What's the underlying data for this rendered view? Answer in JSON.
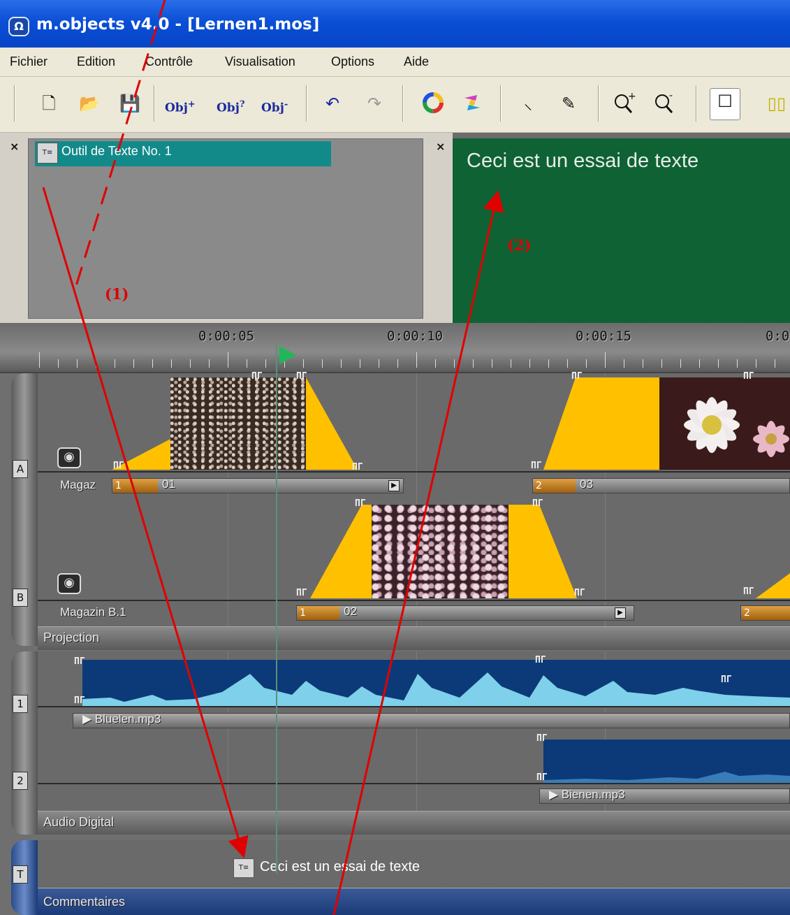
{
  "window": {
    "title": "m.objects v4.0 - [Lernen1.mos]",
    "icon": "m-objects-logo-icon"
  },
  "menu": {
    "items": [
      "Fichier",
      "Edition",
      "Contrôle",
      "Visualisation",
      "Options",
      "Aide"
    ]
  },
  "toolbar": {
    "icons": [
      "new-document-icon",
      "open-folder-icon",
      "save-icon",
      "obj-add",
      "obj-query",
      "obj-remove",
      "undo-icon",
      "redo-icon",
      "color-wheel-icon",
      "color-swap-icon",
      "pick-tool-icon",
      "pencil-tool-icon",
      "zoom-in-icon",
      "zoom-out-icon",
      "single-view-icon",
      "dual-view-icon"
    ],
    "obj_add": "Obj",
    "obj_query": "Obj",
    "obj_remove": "Obj"
  },
  "tool_panel": {
    "item_label": "Outil de Texte No. 1",
    "selected_color": "#138a8a"
  },
  "preview": {
    "text": "Ceci est un essai de texte",
    "background": "#0e6234"
  },
  "ruler": {
    "labels": [
      "0:00:05",
      "0:00:10",
      "0:00:15",
      "0:0"
    ]
  },
  "projection": {
    "lane_a": {
      "badge": "A",
      "magazine": "Magaz",
      "slides": [
        {
          "num": "1",
          "name": "01"
        },
        {
          "num": "2",
          "name": "03"
        }
      ]
    },
    "lane_b": {
      "badge": "B",
      "magazine": "Magazin B.1",
      "slides": [
        {
          "num": "1",
          "name": "02"
        },
        {
          "num": "2",
          "name": ""
        }
      ]
    },
    "label": "Projection"
  },
  "audio": {
    "lane_1": {
      "badge": "1",
      "file": "Bluelen.mp3"
    },
    "lane_2": {
      "badge": "2",
      "file": "Bienen.mp3"
    },
    "label": "Audio Digital"
  },
  "comments": {
    "badge": "T",
    "item_text": "Ceci est un essai de texte",
    "label": "Commentaires"
  },
  "annotations": {
    "label_1": "(1)",
    "label_2": "(2)",
    "color": "#e00000"
  },
  "colors": {
    "titlebar": "#0a4fd6",
    "fade_ramp": "#ffc000",
    "waveform_dark": "#0c3a78",
    "waveform_light": "#7fd0ea"
  }
}
